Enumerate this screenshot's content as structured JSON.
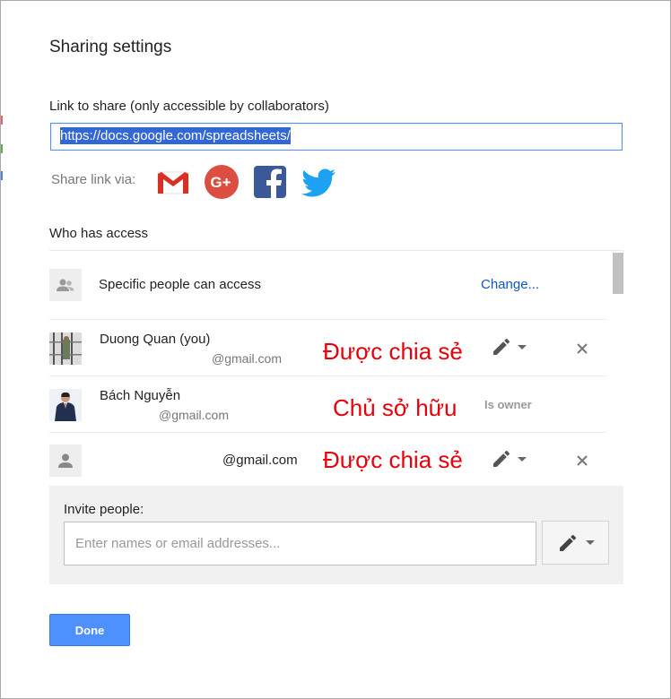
{
  "dialog": {
    "title": "Sharing settings"
  },
  "link": {
    "label": "Link to share (only accessible by collaborators)",
    "url": "https://docs.google.com/spreadsheets/"
  },
  "share_via": {
    "label": "Share link via:",
    "services": [
      "gmail-icon",
      "google-plus-icon",
      "facebook-icon",
      "twitter-icon"
    ]
  },
  "access": {
    "heading": "Who has access",
    "setting": "Specific people can access",
    "change_label": "Change...",
    "people": [
      {
        "name": "Duong Quan (you)",
        "email": "@gmail.com",
        "annotation": "Được chia sẻ",
        "role": "can-edit"
      },
      {
        "name": "Bách Nguyễn",
        "email": "@gmail.com",
        "annotation": "Chủ sở hữu",
        "role_label": "Is owner"
      },
      {
        "name": "",
        "email": "@gmail.com",
        "annotation": "Được chia sẻ",
        "role": "can-edit"
      }
    ]
  },
  "invite": {
    "label": "Invite people:",
    "placeholder": "Enter names or email addresses...",
    "value": ""
  },
  "actions": {
    "done_label": "Done"
  },
  "colors": {
    "primary_button": "#4d90fe",
    "link": "#1155cc",
    "annotation": "#e8000b",
    "gmail": "#d93025",
    "google_plus": "#dc4e41",
    "facebook": "#3b5998",
    "twitter": "#1da1f2"
  }
}
